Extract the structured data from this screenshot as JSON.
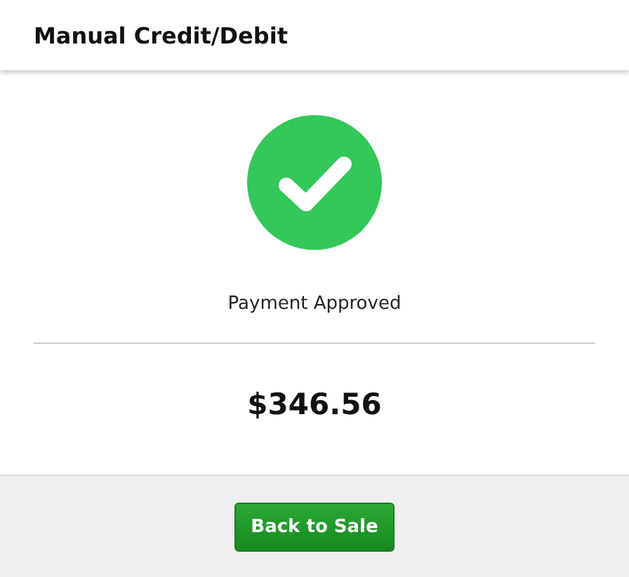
{
  "dialog": {
    "title": "Manual Credit/Debit"
  },
  "result": {
    "approved": true,
    "message": "Payment Approved",
    "amount": "$346.56"
  },
  "buttons": [
    {
      "label": "Back to Sale"
    }
  ]
}
